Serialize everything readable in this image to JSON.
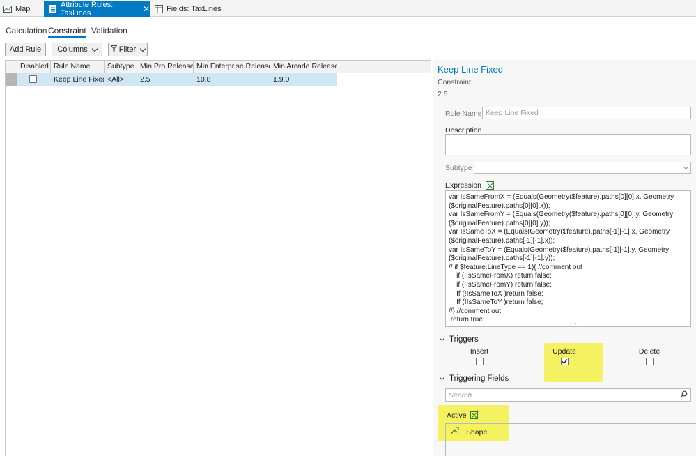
{
  "tabs": [
    {
      "label": "Map",
      "icon": "map-icon",
      "active": false
    },
    {
      "label": "Attribute Rules: TaxLines",
      "icon": "attribute-rules-icon",
      "active": true
    },
    {
      "label": "Fields: TaxLines",
      "icon": "fields-table-icon",
      "active": false
    }
  ],
  "subtabs": [
    "Calculation",
    "Constraint",
    "Validation"
  ],
  "active_subtab": "Constraint",
  "toolbar": {
    "add_rule": "Add Rule",
    "columns": "Columns",
    "filter": "Filter"
  },
  "table": {
    "columns": [
      "Disabled",
      "Rule Name",
      "Subtype",
      "Min Pro Release",
      "Min Enterprise Release",
      "Min Arcade Release"
    ],
    "rows": [
      {
        "disabled": false,
        "rule_name": "Keep Line Fixed",
        "subtype": "<All>",
        "min_pro": "2.5",
        "min_enterprise": "10.8",
        "min_arcade": "1.9.0"
      }
    ]
  },
  "detail": {
    "title": "Keep Line Fixed",
    "type": "Constraint",
    "version": "2.5",
    "rule_name_label": "Rule Name",
    "rule_name_value": "Keep Line Fixed",
    "description_label": "Description",
    "description_value": "",
    "subtype_label": "Subtype",
    "subtype_value": "",
    "expression_label": "Expression",
    "expression": "var IsSameFromX = (Equals(Geometry($feature).paths[0][0].x, Geometry\n($originalFeature).paths[0][0].x));\nvar IsSameFromY = (Equals(Geometry($feature).paths[0][0].y, Geometry\n($originalFeature).paths[0][0].y));\nvar IsSameToX = (Equals(Geometry($feature).paths[-1][-1].x, Geometry\n($originalFeature).paths[-1][-1].x));\nvar IsSameToY = (Equals(Geometry($feature).paths[-1][-1].y, Geometry\n($originalFeature).paths[-1][-1].y));\n// if $feature.LineType == 1){ //comment out\n    if (!IsSameFromX) return false;\n    if (!IsSameFromY) return false;\n    If (!IsSameToX )return false;\n    If (!IsSameToY )return false;\n//} //comment out\n return true;",
    "triggers_label": "Triggers",
    "triggers": [
      {
        "label": "Insert",
        "checked": false
      },
      {
        "label": "Update",
        "checked": true
      },
      {
        "label": "Delete",
        "checked": false
      }
    ],
    "triggering_fields_label": "Triggering Fields",
    "search_placeholder": "Search",
    "active_label": "Active",
    "active_fields": [
      "Shape"
    ]
  },
  "colors": {
    "accent": "#007ac2",
    "selected_row": "#cfe6f5",
    "highlight": "#f5f148"
  }
}
